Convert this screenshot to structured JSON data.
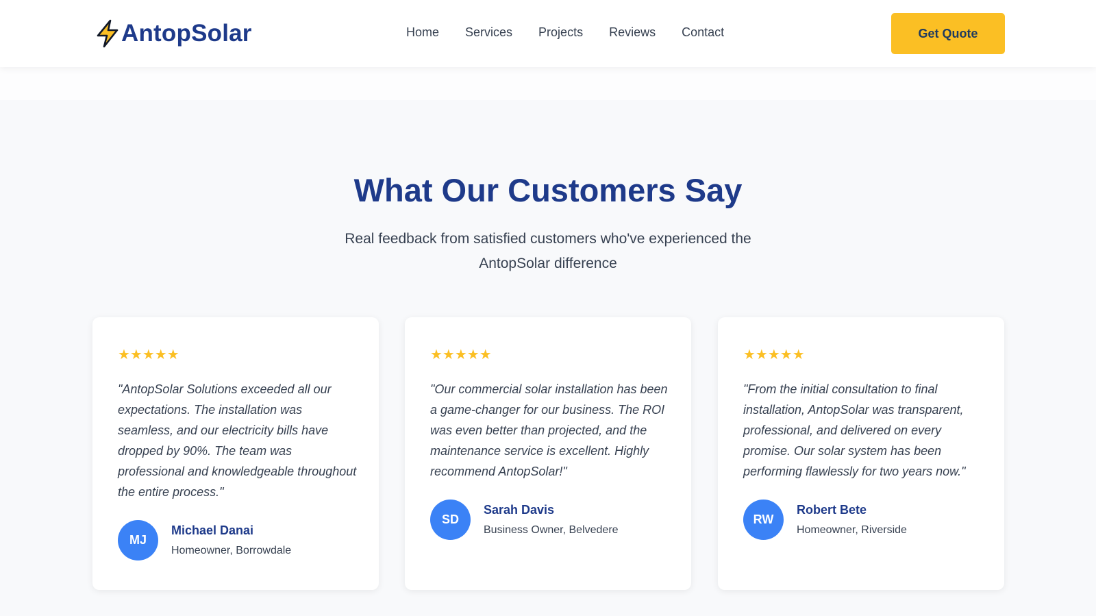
{
  "brand": {
    "name": "AntopSolar",
    "icon": "lightning-bolt-icon",
    "color": "#1e3a8a"
  },
  "nav": {
    "links": [
      "Home",
      "Services",
      "Projects",
      "Reviews",
      "Contact"
    ],
    "cta_label": "Get Quote"
  },
  "testimonials": {
    "title": "What Our Customers Say",
    "subtitle": "Real feedback from satisfied customers who've experienced the AntopSolar difference",
    "cards": [
      {
        "stars": "★★★★★",
        "quote": "\"AntopSolar Solutions exceeded all our expectations. The installation was seamless, and our electricity bills have dropped by 90%. The team was professional and knowledgeable throughout the entire process.\"",
        "initials": "MJ",
        "name": "Michael Danai",
        "role": "Homeowner, Borrowdale"
      },
      {
        "stars": "★★★★★",
        "quote": "\"Our commercial solar installation has been a game-changer for our business. The ROI was even better than projected, and the maintenance service is excellent. Highly recommend AntopSolar!\"",
        "initials": "SD",
        "name": "Sarah Davis",
        "role": "Business Owner, Belvedere"
      },
      {
        "stars": "★★★★★",
        "quote": "\"From the initial consultation to final installation, AntopSolar was transparent, professional, and delivered on every promise. Our solar system has been performing flawlessly for two years now.\"",
        "initials": "RW",
        "name": "Robert Bete",
        "role": "Homeowner, Riverside"
      }
    ]
  },
  "colors": {
    "accent": "#fbbf24",
    "primary": "#1e3a8a",
    "avatar": "#3b82f6"
  }
}
